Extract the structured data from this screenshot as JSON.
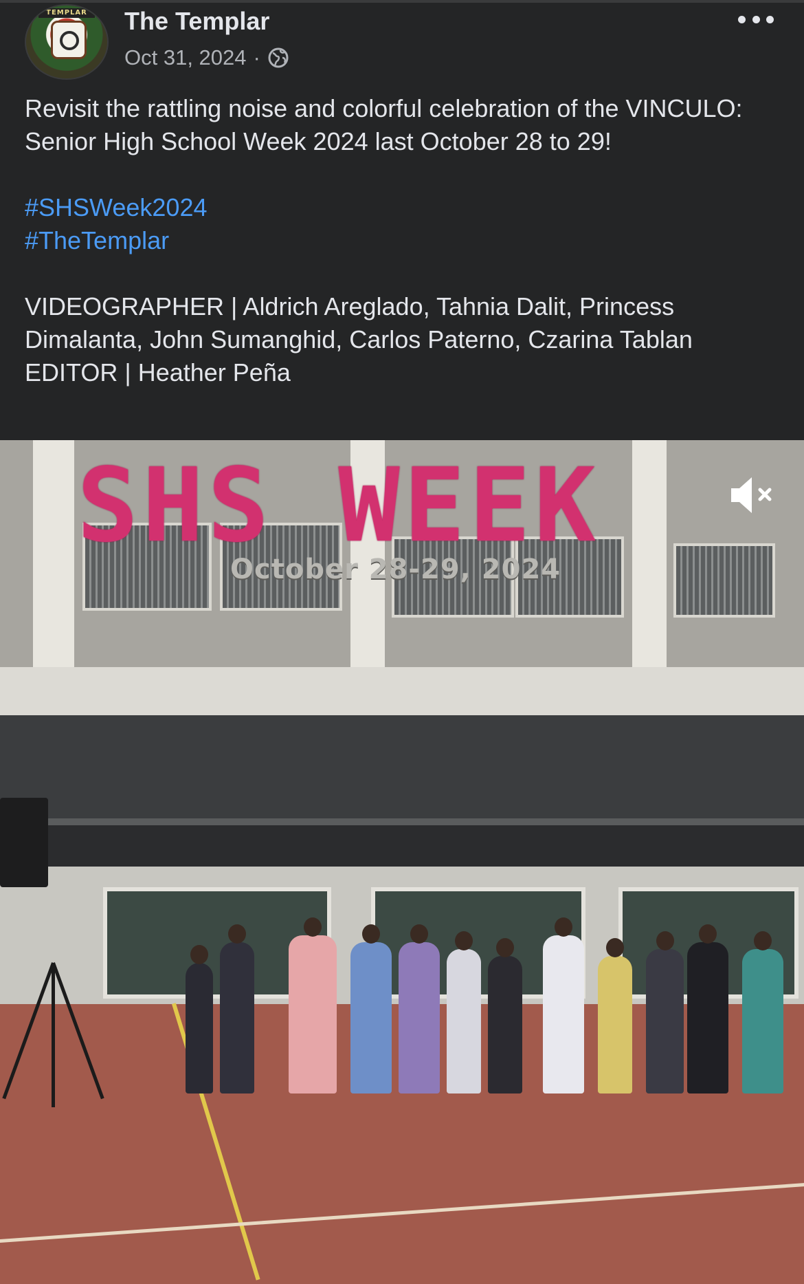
{
  "post": {
    "page_name": "The Templar",
    "date": "Oct 31, 2024",
    "separator": "·",
    "avatar_banner": "TEMPLAR",
    "privacy_icon": "globe-icon",
    "menu_icon": "more-horizontal-icon",
    "body_line1": "Revisit the rattling noise and colorful celebration of the VINCULO: Senior High School Week 2024 last October 28 to 29!",
    "hashtags": [
      "#SHSWeek2024",
      "#TheTemplar"
    ],
    "credits_videographer": "VIDEOGRAPHER | Aldrich Areglado, Tahnia Dalit, Princess Dimalanta, John Sumanghid, Carlos Paterno, Czarina Tablan",
    "credits_editor": "EDITOR | Heather Peña"
  },
  "video": {
    "overlay_title": "SHS WEEK",
    "overlay_date": "October 28-29, 2024",
    "mute_icon": "speaker-muted-icon"
  },
  "colors": {
    "background": "#242526",
    "text": "#e4e6eb",
    "muted_text": "#b0b3b8",
    "hashtag": "#4b9bf5",
    "overlay_title": "#d2316f"
  }
}
